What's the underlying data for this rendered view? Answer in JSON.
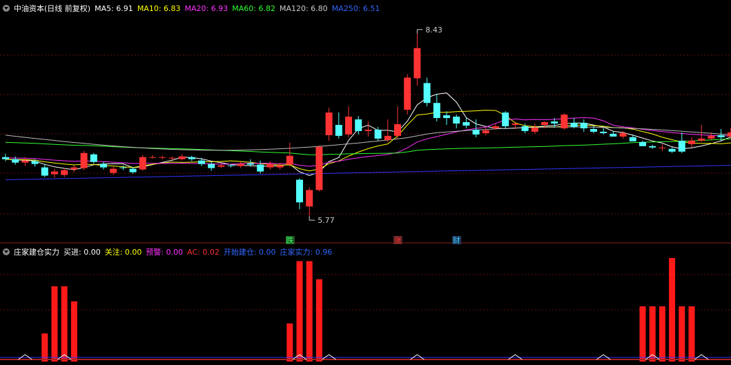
{
  "main_header": {
    "title": "中油资本(日线 前复权)",
    "ma": [
      {
        "label": "MA5: 6.91",
        "color": "#ffffff"
      },
      {
        "label": "MA10: 6.83",
        "color": "#ffff00"
      },
      {
        "label": "MA20: 6.93",
        "color": "#ff33ff"
      },
      {
        "label": "MA60: 6.82",
        "color": "#33ff33"
      },
      {
        "label": "MA120: 6.80",
        "color": "#cccccc"
      },
      {
        "label": "MA250: 6.51",
        "color": "#3333ff"
      }
    ]
  },
  "sub_header": {
    "title": "庄家建仓实力",
    "items": [
      {
        "label": "买进: 0.00",
        "color": "#ffffff"
      },
      {
        "label": "关注: 0.00",
        "color": "#ffff00"
      },
      {
        "label": "预警: 0.00",
        "color": "#ff33ff"
      },
      {
        "label": "AC: 0.02",
        "color": "#ff3333"
      },
      {
        "label": "开始建仓: 0.00",
        "color": "#3366ff"
      },
      {
        "label": "庄家实力: 0.96",
        "color": "#3366ff"
      }
    ]
  },
  "chart_data": [
    {
      "type": "candlestick",
      "ylim": [
        5.5,
        8.7
      ],
      "high_label": "8.43",
      "low_label": "5.77",
      "markers": [
        {
          "index": 29,
          "text": "跌",
          "color": "#33ff66",
          "bg": "#225522"
        },
        {
          "index": 40,
          "text": "涨",
          "color": "#ff3333",
          "bg": "#552222"
        },
        {
          "index": 46,
          "text": "财",
          "color": "#33ccff",
          "bg": "#223355"
        }
      ],
      "candles": [
        [
          6.63,
          6.6,
          6.68,
          6.57
        ],
        [
          6.6,
          6.55,
          6.64,
          6.52
        ],
        [
          6.55,
          6.58,
          6.63,
          6.5
        ],
        [
          6.57,
          6.53,
          6.6,
          6.49
        ],
        [
          6.48,
          6.36,
          6.52,
          6.34
        ],
        [
          6.38,
          6.42,
          6.46,
          6.33
        ],
        [
          6.37,
          6.44,
          6.47,
          6.34
        ],
        [
          6.45,
          6.48,
          6.51,
          6.41
        ],
        [
          6.47,
          6.69,
          6.72,
          6.44
        ],
        [
          6.67,
          6.56,
          6.69,
          6.53
        ],
        [
          6.53,
          6.48,
          6.56,
          6.45
        ],
        [
          6.4,
          6.46,
          6.49,
          6.37
        ],
        [
          6.48,
          6.47,
          6.51,
          6.44
        ],
        [
          6.46,
          6.41,
          6.49,
          6.39
        ],
        [
          6.45,
          6.63,
          6.66,
          6.43
        ],
        [
          6.63,
          6.63,
          6.66,
          6.61
        ],
        [
          6.62,
          6.63,
          6.65,
          6.6
        ],
        [
          6.61,
          6.62,
          6.64,
          6.59
        ],
        [
          6.6,
          6.64,
          6.67,
          6.58
        ],
        [
          6.63,
          6.6,
          6.65,
          6.57
        ],
        [
          6.58,
          6.53,
          6.62,
          6.5
        ],
        [
          6.53,
          6.47,
          6.56,
          6.43
        ],
        [
          6.49,
          6.51,
          6.54,
          6.47
        ],
        [
          6.51,
          6.5,
          6.53,
          6.48
        ],
        [
          6.5,
          6.53,
          6.56,
          6.47
        ],
        [
          6.54,
          6.52,
          6.6,
          6.49
        ],
        [
          6.52,
          6.42,
          6.58,
          6.39
        ],
        [
          6.48,
          6.53,
          6.57,
          6.45
        ],
        [
          6.48,
          6.51,
          6.55,
          6.45
        ],
        [
          6.52,
          6.65,
          6.84,
          6.49
        ],
        [
          6.3,
          5.97,
          6.32,
          5.87
        ],
        [
          5.91,
          6.15,
          6.19,
          5.77
        ],
        [
          6.15,
          6.78,
          6.8,
          6.13
        ],
        [
          6.95,
          7.28,
          7.35,
          6.87
        ],
        [
          7.1,
          6.94,
          7.28,
          6.9
        ],
        [
          6.96,
          7.22,
          7.37,
          6.92
        ],
        [
          7.18,
          7.01,
          7.23,
          6.96
        ],
        [
          7.01,
          7.03,
          7.15,
          6.93
        ],
        [
          7.03,
          6.9,
          7.07,
          6.87
        ],
        [
          6.88,
          6.94,
          7.18,
          6.85
        ],
        [
          6.94,
          7.11,
          7.37,
          6.9
        ],
        [
          7.32,
          7.79,
          7.84,
          7.25
        ],
        [
          7.78,
          8.22,
          8.43,
          7.67
        ],
        [
          7.71,
          7.42,
          7.79,
          7.37
        ],
        [
          7.42,
          7.2,
          7.55,
          7.15
        ],
        [
          7.24,
          7.2,
          7.3,
          7.1
        ],
        [
          7.22,
          7.12,
          7.25,
          7.05
        ],
        [
          7.14,
          7.09,
          7.2,
          7.05
        ],
        [
          7.03,
          6.96,
          7.18,
          6.92
        ],
        [
          6.98,
          7.02,
          7.06,
          6.95
        ],
        [
          7.05,
          7.08,
          7.12,
          7.03
        ],
        [
          7.28,
          7.08,
          7.3,
          7.05
        ],
        [
          7.1,
          7.12,
          7.14,
          7.04
        ],
        [
          7.08,
          7.01,
          7.12,
          6.98
        ],
        [
          7.0,
          7.06,
          7.12,
          6.97
        ],
        [
          7.1,
          7.14,
          7.15,
          7.05
        ],
        [
          7.15,
          7.12,
          7.2,
          7.06
        ],
        [
          7.05,
          7.25,
          7.27,
          7.03
        ],
        [
          7.13,
          7.07,
          7.2,
          7.05
        ],
        [
          7.13,
          7.05,
          7.18,
          7.0
        ],
        [
          7.04,
          7.0,
          7.09,
          6.98
        ],
        [
          7.0,
          6.98,
          7.06,
          6.96
        ],
        [
          6.97,
          6.93,
          7.01,
          6.93
        ],
        [
          6.93,
          6.98,
          7.01,
          6.9
        ],
        [
          6.92,
          6.86,
          6.95,
          6.86
        ],
        [
          6.85,
          6.79,
          6.87,
          6.79
        ],
        [
          6.79,
          6.77,
          6.81,
          6.75
        ],
        [
          6.77,
          6.77,
          6.82,
          6.72
        ],
        [
          6.75,
          6.71,
          6.78,
          6.69
        ],
        [
          6.87,
          6.71,
          6.99,
          6.69
        ],
        [
          6.82,
          6.87,
          6.92,
          6.77
        ],
        [
          6.87,
          6.9,
          7.1,
          6.85
        ],
        [
          6.9,
          6.94,
          6.99,
          6.88
        ],
        [
          6.95,
          6.92,
          7.04,
          6.87
        ],
        [
          6.93,
          6.99,
          7.06,
          6.9
        ]
      ],
      "series": [
        {
          "name": "MA5",
          "color": "#ffffff"
        },
        {
          "name": "MA10",
          "color": "#ffff00"
        },
        {
          "name": "MA20",
          "color": "#ff33ff"
        },
        {
          "name": "MA60",
          "color": "#33ff33"
        },
        {
          "name": "MA120",
          "color": "#bbbbbb"
        },
        {
          "name": "MA250",
          "color": "#3333ff"
        }
      ]
    },
    {
      "type": "bar",
      "ylim": [
        0,
        1.0
      ],
      "values": [
        0,
        0,
        0,
        0,
        0.28,
        0.75,
        0.75,
        0.6,
        0,
        0,
        0,
        0,
        0,
        0,
        0,
        0,
        0,
        0,
        0,
        0,
        0,
        0,
        0,
        0,
        0,
        0,
        0,
        0,
        0,
        0.38,
        1.0,
        1.0,
        0.82,
        0,
        0,
        0,
        0,
        0,
        0,
        0,
        0,
        0,
        0,
        0,
        0,
        0,
        0,
        0,
        0,
        0,
        0,
        0,
        0,
        0,
        0,
        0,
        0,
        0,
        0,
        0,
        0,
        0,
        0,
        0,
        0,
        0.55,
        0.55,
        0.55,
        1.07,
        0.55,
        0.55,
        0,
        0,
        0,
        0
      ]
    }
  ]
}
